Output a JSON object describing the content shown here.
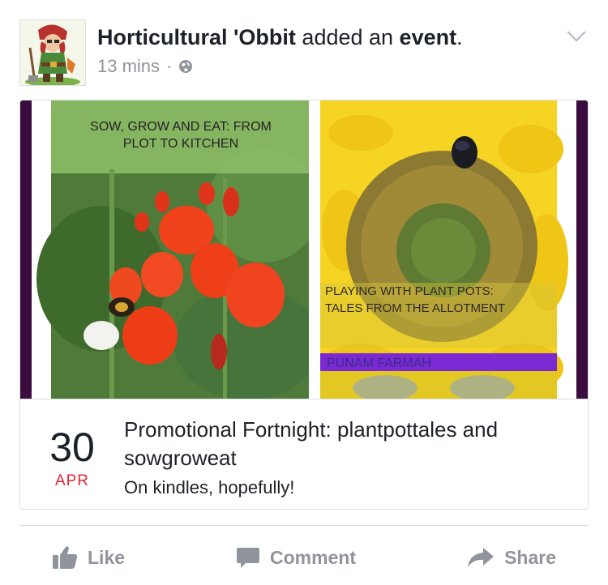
{
  "post": {
    "author": "Horticultural 'Obbit",
    "action_text": " added an ",
    "object_text": "event",
    "period": ".",
    "timestamp": "13 mins",
    "separator": "·",
    "privacy_icon": "globe-icon"
  },
  "cover": {
    "left_book_title_line1": "SOW, GROW AND EAT: FROM",
    "left_book_title_line2": "PLOT TO KITCHEN",
    "right_book_title_line1": "PLAYING WITH PLANT POTS:",
    "right_book_title_line2": "TALES FROM THE ALLOTMENT",
    "right_book_author": "PUNAM FARMAH"
  },
  "event": {
    "day": "30",
    "month": "APR",
    "title": "Promotional Fortnight: plantpottales and sowgroweat",
    "subtitle": "On kindles, hopefully!"
  },
  "actions": {
    "like": "Like",
    "comment": "Comment",
    "share": "Share"
  },
  "colors": {
    "month_red": "#e0262f",
    "meta_gray": "#90949c",
    "border_gray": "#dddfe2"
  }
}
